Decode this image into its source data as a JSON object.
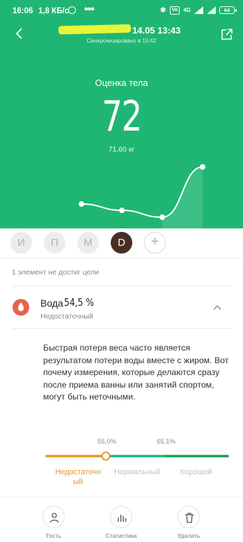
{
  "status_bar": {
    "time": "16:06",
    "network_speed": "1,8 КБ/с",
    "overflow_dots": "•••",
    "lte_label": "4G",
    "volte_label": "Vo",
    "battery": "64"
  },
  "header": {
    "date_time": "14.05 13:43",
    "sync_status": "Синхронизировано в 15:42"
  },
  "metric": {
    "title": "Оценка тела",
    "value": "72",
    "weight": "71,60  кг"
  },
  "trend_data": {
    "values": [
      72,
      70.8,
      69.5,
      79
    ],
    "color": "#ffffff"
  },
  "users": {
    "items": [
      {
        "label": "И",
        "active": false
      },
      {
        "label": "П",
        "active": false
      },
      {
        "label": "М",
        "active": false
      },
      {
        "label": "D",
        "active": true
      }
    ],
    "add_label": "+"
  },
  "notice": "1 элемент не достиг цели",
  "water": {
    "label": "Вода",
    "value": "54,5 %",
    "status": "Недостаточный",
    "icon": "water-drop-icon",
    "icon_color": "#e8624d",
    "description": "Быстрая потеря веса часто является результатом потери воды вместе с жиром. Вот почему измерения, которые делаются сразу после приема ванны или занятий спортом, могут быть неточными.",
    "current_level": 55.0
  },
  "scale": {
    "threshold_low": "55,0%",
    "threshold_high": "65,1%",
    "bands": [
      {
        "label": "Недостаточн\nый",
        "color": "#e8962b"
      },
      {
        "label": "Нормальный",
        "color": "#1fb674"
      },
      {
        "label": "Хороший",
        "color": "#1a9e5c"
      }
    ]
  },
  "bottom_nav": {
    "items": [
      {
        "label": "Гость",
        "icon": "person-icon"
      },
      {
        "label": "Статистика",
        "icon": "bar-chart-icon"
      },
      {
        "label": "Удалить",
        "icon": "trash-icon"
      }
    ]
  },
  "colors": {
    "primary": "#1fb674",
    "warning": "#e8962b",
    "active_user": "#4a2e24"
  }
}
